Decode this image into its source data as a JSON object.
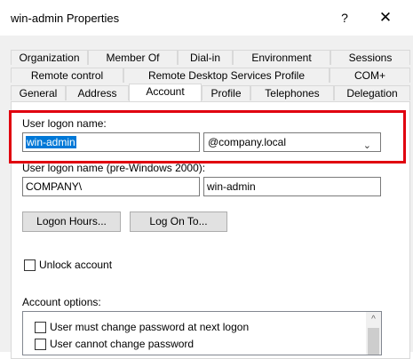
{
  "window": {
    "title": "win-admin Properties",
    "help": "?",
    "close": "✕"
  },
  "tabs": {
    "row1": [
      "Organization",
      "Member Of",
      "Dial-in",
      "Environment",
      "Sessions"
    ],
    "row2": [
      "Remote control",
      "Remote Desktop Services Profile",
      "COM+"
    ],
    "row3": [
      "General",
      "Address",
      "Account",
      "Profile",
      "Telephones",
      "Delegation"
    ],
    "active": "Account"
  },
  "account": {
    "logon_label": "User logon name:",
    "logon_value": "win-admin",
    "domain_value": "@company.local",
    "pre2000_label": "User logon name (pre-Windows 2000):",
    "pre2000_domain": "COMPANY\\",
    "pre2000_user": "win-admin",
    "logon_hours_button": "Logon Hours...",
    "log_on_to_button": "Log On To...",
    "unlock_label": "Unlock account",
    "options_label": "Account options:",
    "options": [
      "User must change password at next logon",
      "User cannot change password"
    ]
  },
  "colors": {
    "highlight": "#e0000f",
    "selection": "#0078d7"
  }
}
